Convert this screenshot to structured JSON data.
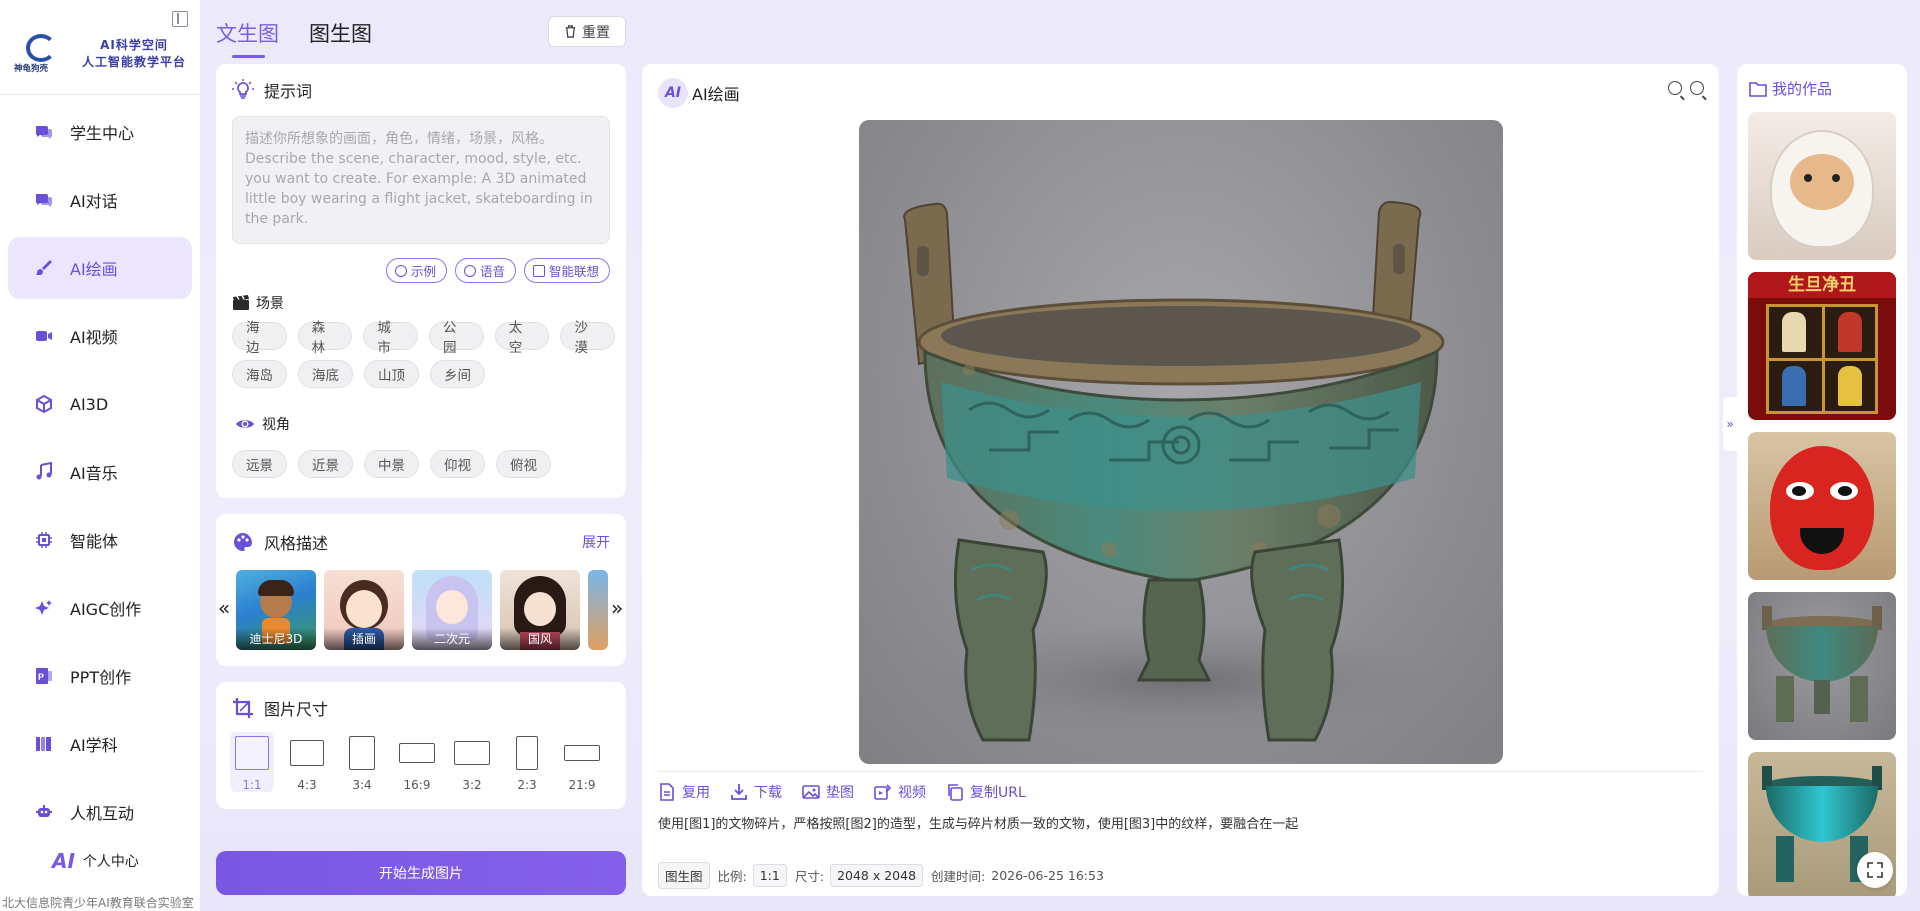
{
  "brand": {
    "logo_caption": "神龟狗壳",
    "line1": "AI科学空间",
    "line2": "人工智能教学平台"
  },
  "nav": {
    "items": [
      {
        "label": "学生中心",
        "icon": "chat-bubbles-icon"
      },
      {
        "label": "AI对话",
        "icon": "chat-bubbles-icon"
      },
      {
        "label": "AI绘画",
        "icon": "brush-icon",
        "active": true
      },
      {
        "label": "AI视频",
        "icon": "video-camera-icon"
      },
      {
        "label": "AI3D",
        "icon": "cube-icon"
      },
      {
        "label": "AI音乐",
        "icon": "music-note-icon"
      },
      {
        "label": "智能体",
        "icon": "chip-icon"
      },
      {
        "label": "AIGC创作",
        "icon": "sparkle-icon"
      },
      {
        "label": "PPT创作",
        "icon": "ppt-icon"
      },
      {
        "label": "AI学科",
        "icon": "books-icon"
      },
      {
        "label": "人机互动",
        "icon": "robot-icon"
      }
    ],
    "profile_label": "个人中心",
    "profile_badge": "AI"
  },
  "footer": "北大信息院青少年AI教育联合实验室",
  "tabs": {
    "text_to_image": "文生图",
    "image_to_image": "图生图",
    "reset": "重置"
  },
  "prompt": {
    "title": "提示词",
    "placeholder": "描述你所想象的画面，角色，情绪，场景，风格。Describe the scene, character, mood, style, etc. you want to create. For example: A 3D animated little boy wearing a flight jacket, skateboarding in the park.",
    "buttons": {
      "example": "示例",
      "voice": "语音",
      "smart": "智能联想"
    }
  },
  "scene": {
    "title": "场景",
    "tags": [
      "海边",
      "森林",
      "城市",
      "公园",
      "太空",
      "沙漠",
      "海岛",
      "海底",
      "山顶",
      "乡间"
    ]
  },
  "view": {
    "title": "视角",
    "tags": [
      "远景",
      "近景",
      "中景",
      "仰视",
      "俯视"
    ]
  },
  "style": {
    "title": "风格描述",
    "expand": "展开",
    "prev": "«",
    "next": "»",
    "items": [
      {
        "label": "迪士尼3D"
      },
      {
        "label": "插画"
      },
      {
        "label": "二次元"
      },
      {
        "label": "国风"
      }
    ]
  },
  "size": {
    "title": "图片尺寸",
    "ratios": [
      "1:1",
      "4:3",
      "3:4",
      "16:9",
      "3:2",
      "2:3",
      "21:9"
    ],
    "selected": "1:1"
  },
  "generate_button": "开始生成图片",
  "canvas": {
    "badge": "AI",
    "title": "AI绘画",
    "actions": [
      "复用",
      "下载",
      "垫图",
      "视频",
      "复制URL"
    ],
    "prompt_text": "使用[图1]的文物碎片，严格按照[图2]的造型，生成与碎片材质一致的文物，使用[图3]中的纹样，要融合在一起",
    "meta": {
      "mode": "图生图",
      "ratio_label": "比例:",
      "ratio": "1:1",
      "size_label": "尺寸:",
      "size": "2048 x 2048",
      "created_label": "创建时间:",
      "created": "2026-06-25 16:53"
    }
  },
  "works": {
    "title": "我的作品",
    "expand_arrow": "»",
    "items": [
      {
        "icon": "puppy-in-egg"
      },
      {
        "icon": "opera-characters-poster",
        "title_text": "生旦净丑"
      },
      {
        "icon": "opera-mask"
      },
      {
        "icon": "bronze-ding"
      },
      {
        "icon": "teal-bronze-ding"
      }
    ]
  }
}
